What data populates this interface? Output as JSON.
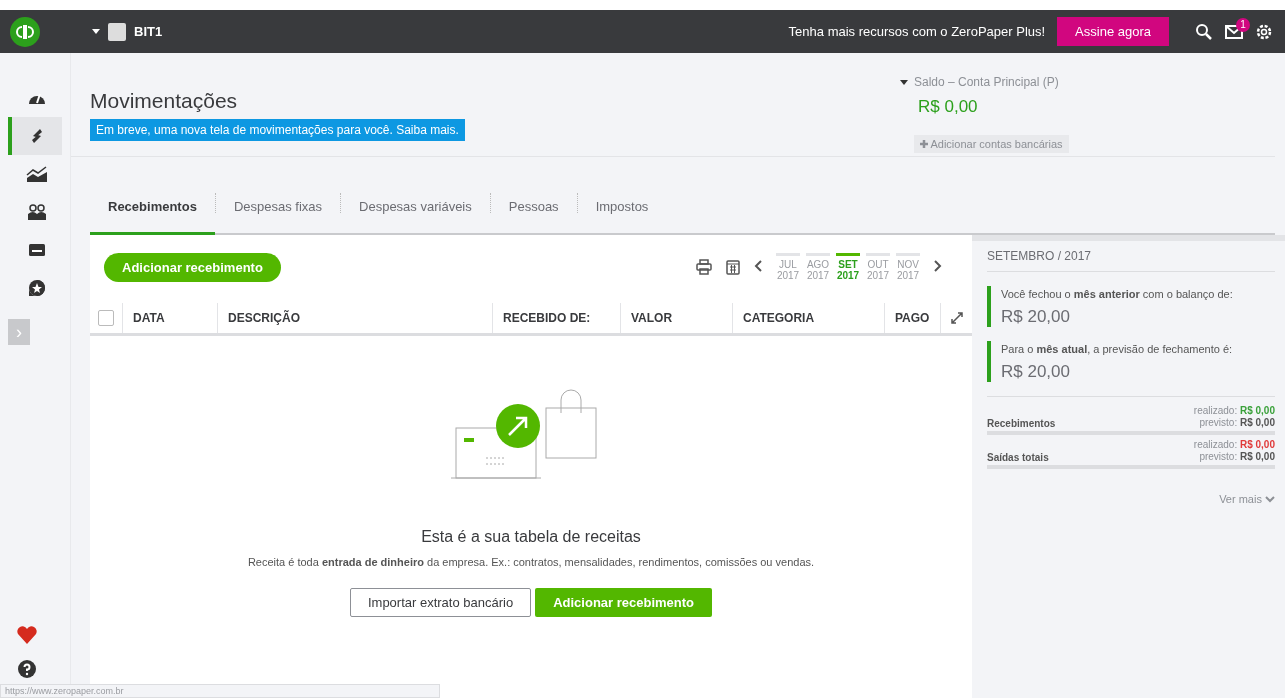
{
  "topbar": {
    "company": "BIT1",
    "promo": "Tenha mais recursos com o ZeroPaper Plus!",
    "cta": "Assine agora",
    "notification_count": "1"
  },
  "sidebar": {
    "items": [
      {
        "kind": "dashboard",
        "selected": false
      },
      {
        "kind": "transfers",
        "selected": true
      },
      {
        "kind": "chart",
        "selected": false
      },
      {
        "kind": "people",
        "selected": false
      },
      {
        "kind": "card",
        "selected": false
      },
      {
        "kind": "star",
        "selected": false
      }
    ],
    "expand": "›"
  },
  "page": {
    "title": "Movimentações",
    "banner": "Em breve, uma nova tela de movimentações para você. Saiba mais."
  },
  "balance": {
    "label": "Saldo – Conta Principal (P)",
    "amount": "R$ 0,00",
    "add_accounts": "Adicionar contas bancárias"
  },
  "tabs": [
    {
      "label": "Recebimentos",
      "selected": true
    },
    {
      "label": "Despesas fixas",
      "selected": false
    },
    {
      "label": "Despesas variáveis",
      "selected": false
    },
    {
      "label": "Pessoas",
      "selected": false
    },
    {
      "label": "Impostos",
      "selected": false
    }
  ],
  "toolbar": {
    "add_button": "Adicionar recebimento",
    "months": [
      {
        "month": "JUL",
        "year": "2017",
        "selected": false
      },
      {
        "month": "AGO",
        "year": "2017",
        "selected": false
      },
      {
        "month": "SET",
        "year": "2017",
        "selected": true
      },
      {
        "month": "OUT",
        "year": "2017",
        "selected": false
      },
      {
        "month": "NOV",
        "year": "2017",
        "selected": false
      }
    ]
  },
  "table": {
    "columns": [
      "DATA",
      "DESCRIÇÃO",
      "RECEBIDO DE:",
      "VALOR",
      "CATEGORIA",
      "PAGO"
    ],
    "select_all_checked": false
  },
  "empty_state": {
    "title": "Esta é a sua tabela de receitas",
    "text": "Receita é toda **entrada de dinheiro** da empresa. Ex.: contratos, mensalidades, rendimentos, comissões ou vendas.",
    "buttons": [
      {
        "label": "Importar extrato bancário",
        "kind": "secondary"
      },
      {
        "label": "Adicionar recebimento",
        "kind": "primary"
      }
    ]
  },
  "summary": {
    "period": "SETEMBRO / 2017",
    "statements": [
      {
        "text": "Você fechou o **mês anterior** com o balanço de:",
        "amount": "R$ 20,00"
      },
      {
        "text": "Para o **mês atual**, a previsão de fechamento é:",
        "amount": "R$ 20,00"
      }
    ],
    "rows": [
      {
        "label": "Recebimentos",
        "realizado_label": "realizado:",
        "realizado": "R$ 0,00",
        "color": "#3aa13a",
        "previsto_label": "previsto:",
        "previsto": "R$ 0,00"
      },
      {
        "label": "Saídas totais",
        "realizado_label": "realizado:",
        "realizado": "R$ 0,00",
        "color": "#e03a3a",
        "previsto_label": "previsto:",
        "previsto": "R$ 0,00"
      }
    ],
    "more": "Ver mais"
  },
  "status_url": "https://www.zeropaper.com.br"
}
